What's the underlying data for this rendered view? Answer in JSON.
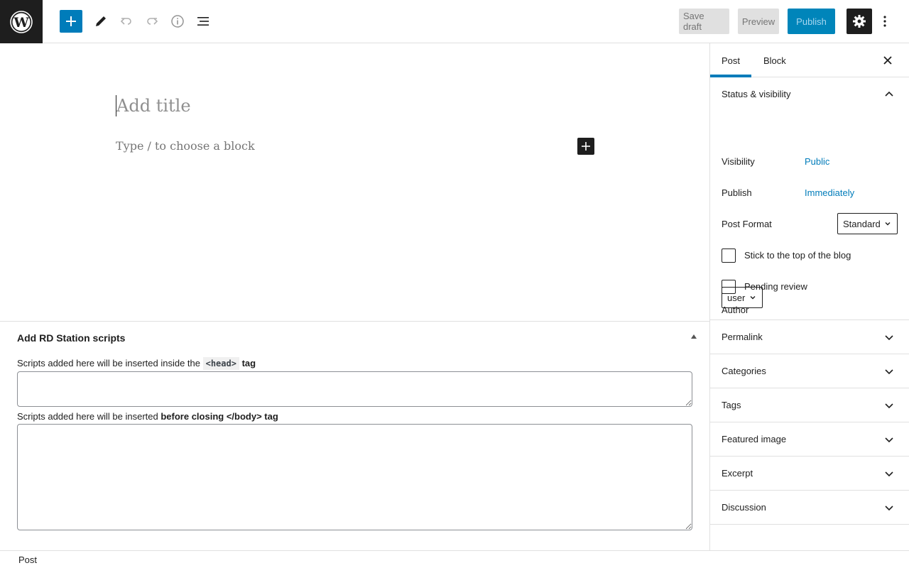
{
  "topbar": {
    "save_draft_label": "Save draft",
    "preview_label": "Preview",
    "publish_label": "Publish"
  },
  "editor": {
    "title_placeholder": "Add title",
    "block_placeholder": "Type / to choose a block"
  },
  "metabox": {
    "title": "Add RD Station scripts",
    "head_label_prefix": "Scripts added here will be inserted inside the",
    "head_label_code": "<head>",
    "head_label_suffix": "tag",
    "body_label_prefix": "Scripts added here will be inserted",
    "body_label_bold": "before closing </body> tag"
  },
  "footer": {
    "breadcrumb": "Post"
  },
  "sidebar": {
    "tabs": [
      {
        "label": "Post",
        "active": true
      },
      {
        "label": "Block",
        "active": false
      }
    ],
    "status_panel": {
      "title": "Status & visibility",
      "visibility_label": "Visibility",
      "visibility_value": "Public",
      "publish_label": "Publish",
      "publish_value": "Immediately",
      "post_format_label": "Post Format",
      "post_format_value": "Standard",
      "sticky_label": "Stick to the top of the blog",
      "pending_label": "Pending review",
      "author_label": "Author",
      "author_value": "user"
    },
    "panels": [
      {
        "title": "Permalink"
      },
      {
        "title": "Categories"
      },
      {
        "title": "Tags"
      },
      {
        "title": "Featured image"
      },
      {
        "title": "Excerpt"
      },
      {
        "title": "Discussion"
      }
    ]
  },
  "colors": {
    "accent": "#007cba",
    "dark": "#1e1e1e",
    "border": "#e0e0e0"
  }
}
